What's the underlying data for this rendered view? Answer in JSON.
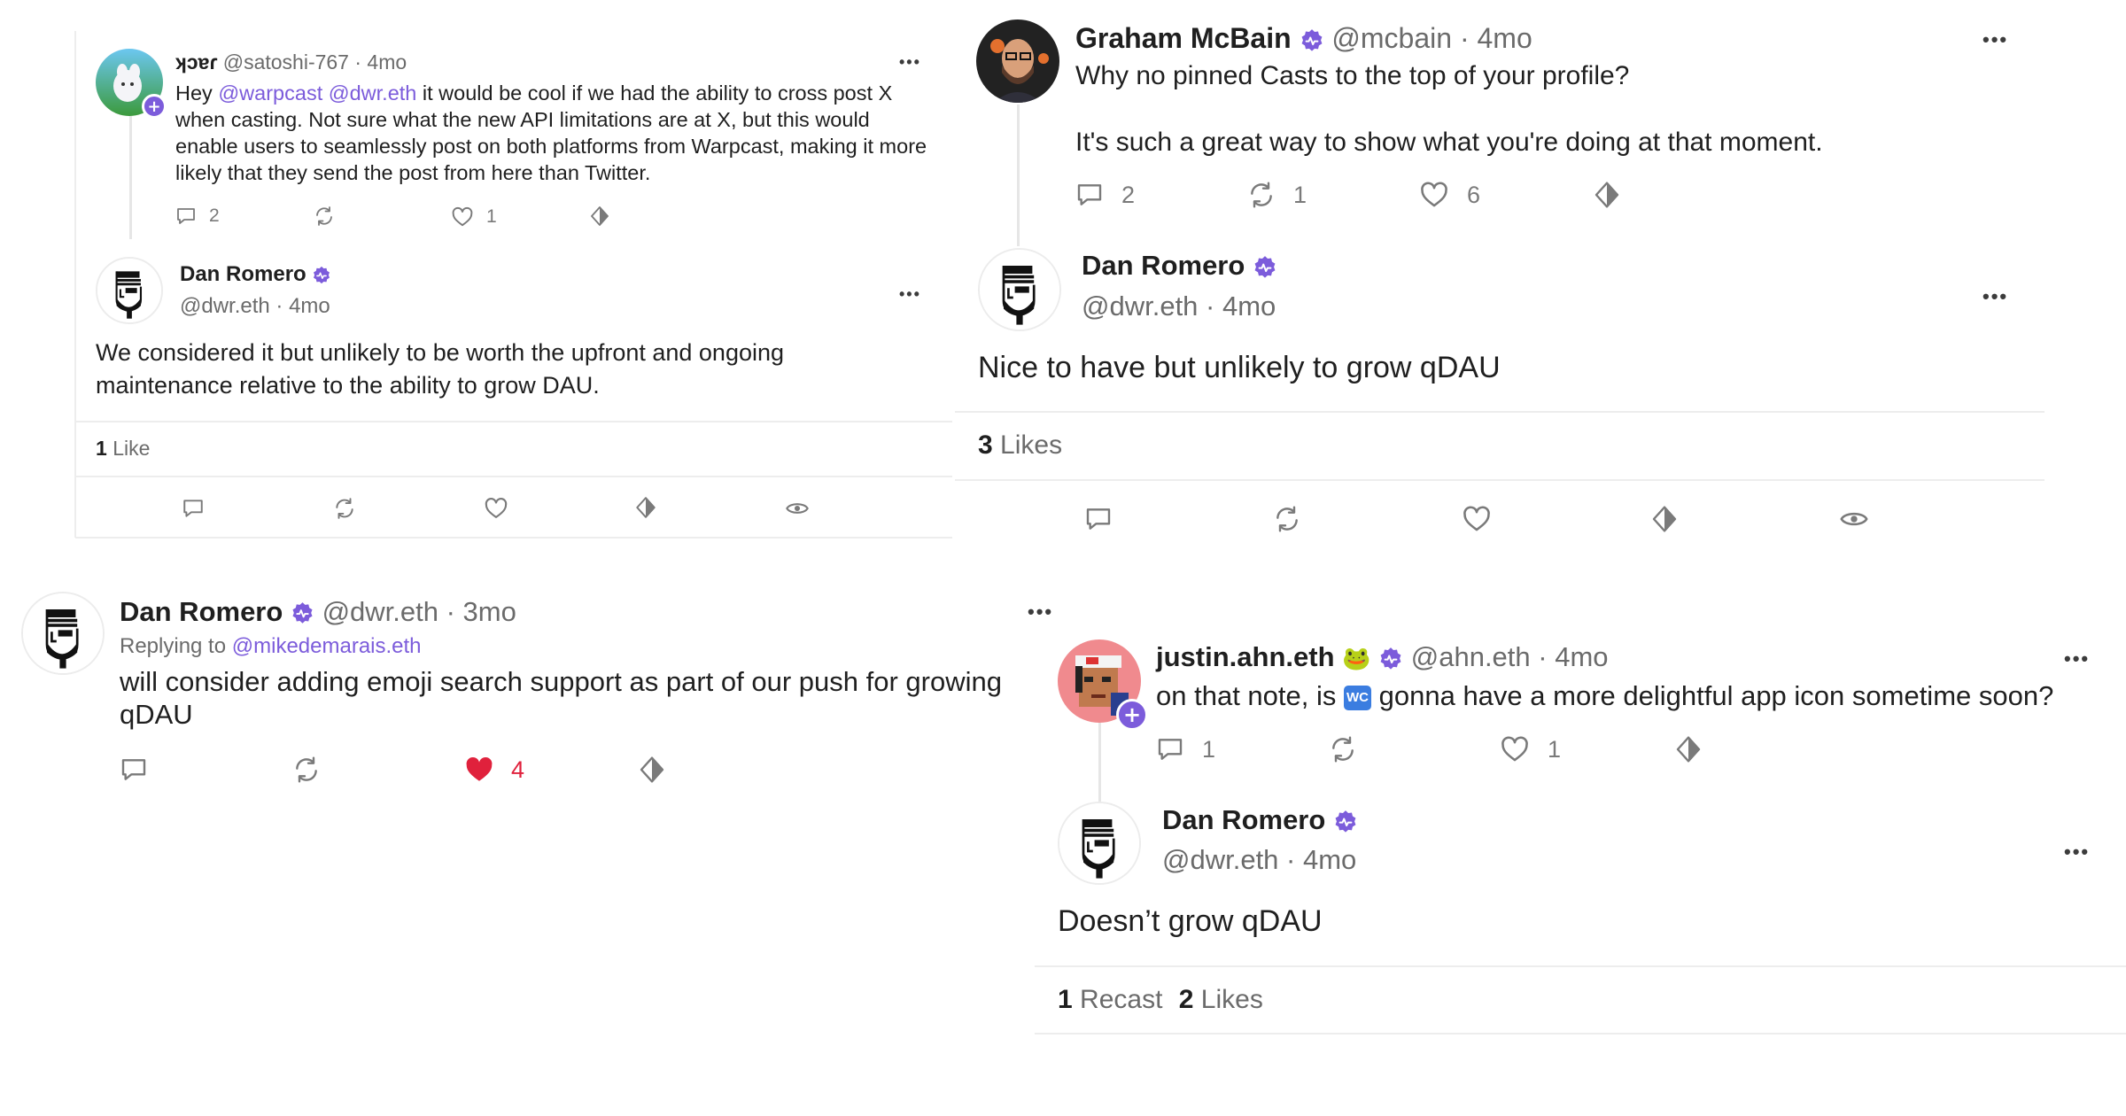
{
  "panels": {
    "p1": {
      "parent": {
        "display_name": "ʞɔɐɾ",
        "handle": "@satoshi-767",
        "time": "· 4mo",
        "text_prefix": "Hey ",
        "mention1": "@warpcast",
        "mention2": "@dwr.eth",
        "text_rest": " it would be cool if we had the ability to cross post X when casting.  Not sure what the new API limitations are at X, but this would enable users to seamlessly post on both platforms from Warpcast, making it more likely that they send the post from here than Twitter.",
        "replies": "2",
        "likes": "1"
      },
      "reply": {
        "display_name": "Dan Romero",
        "handle_time": "@dwr.eth · 4mo",
        "text": "We considered it but unlikely to be worth the upfront and ongoing maintenance relative to the ability to grow DAU.",
        "like_count": "1",
        "like_label": "Like"
      }
    },
    "p2": {
      "parent": {
        "display_name": "Graham McBain",
        "handle_time": "@mcbain · 4mo",
        "line1": "Why no pinned Casts to the top of your profile?",
        "line2": "It's such a great way to show what you're doing at that moment.",
        "replies": "2",
        "recasts": "1",
        "likes": "6"
      },
      "reply": {
        "display_name": "Dan Romero",
        "handle_time": "@dwr.eth · 4mo",
        "text": "Nice to have but unlikely to grow qDAU",
        "like_count": "3",
        "like_label": "Likes"
      }
    },
    "p3": {
      "display_name": "Dan Romero",
      "handle_time": "@dwr.eth · 3mo",
      "replying_prefix": "Replying to",
      "replying_to": "@mikedemarais.eth",
      "text": "will consider adding emoji search support as part of our push for growing qDAU",
      "likes": "4"
    },
    "p4": {
      "parent": {
        "display_name": "justin.ahn.eth",
        "emoji": "🐸",
        "handle_time": "@ahn.eth · 4mo",
        "text_prefix": "on that note, is",
        "wc_emoji": "WC",
        "text_rest": "gonna have a more delightful app icon sometime soon?",
        "replies": "1",
        "likes": "1"
      },
      "reply": {
        "display_name": "Dan Romero",
        "handle_time": "@dwr.eth · 4mo",
        "text": "Doesn’t grow qDAU",
        "recast_count": "1",
        "recast_label": "Recast",
        "like_count": "2",
        "like_label": "Likes"
      }
    }
  },
  "more_glyph": "•••",
  "colors": {
    "accent": "#7c5cdb",
    "liked": "#e0213c",
    "muted": "#6b6b6b"
  },
  "icons": [
    "reply-icon",
    "recast-icon",
    "like-icon",
    "tip-diamond-icon",
    "views-eye-icon",
    "verified-badge-icon",
    "more-icon"
  ]
}
